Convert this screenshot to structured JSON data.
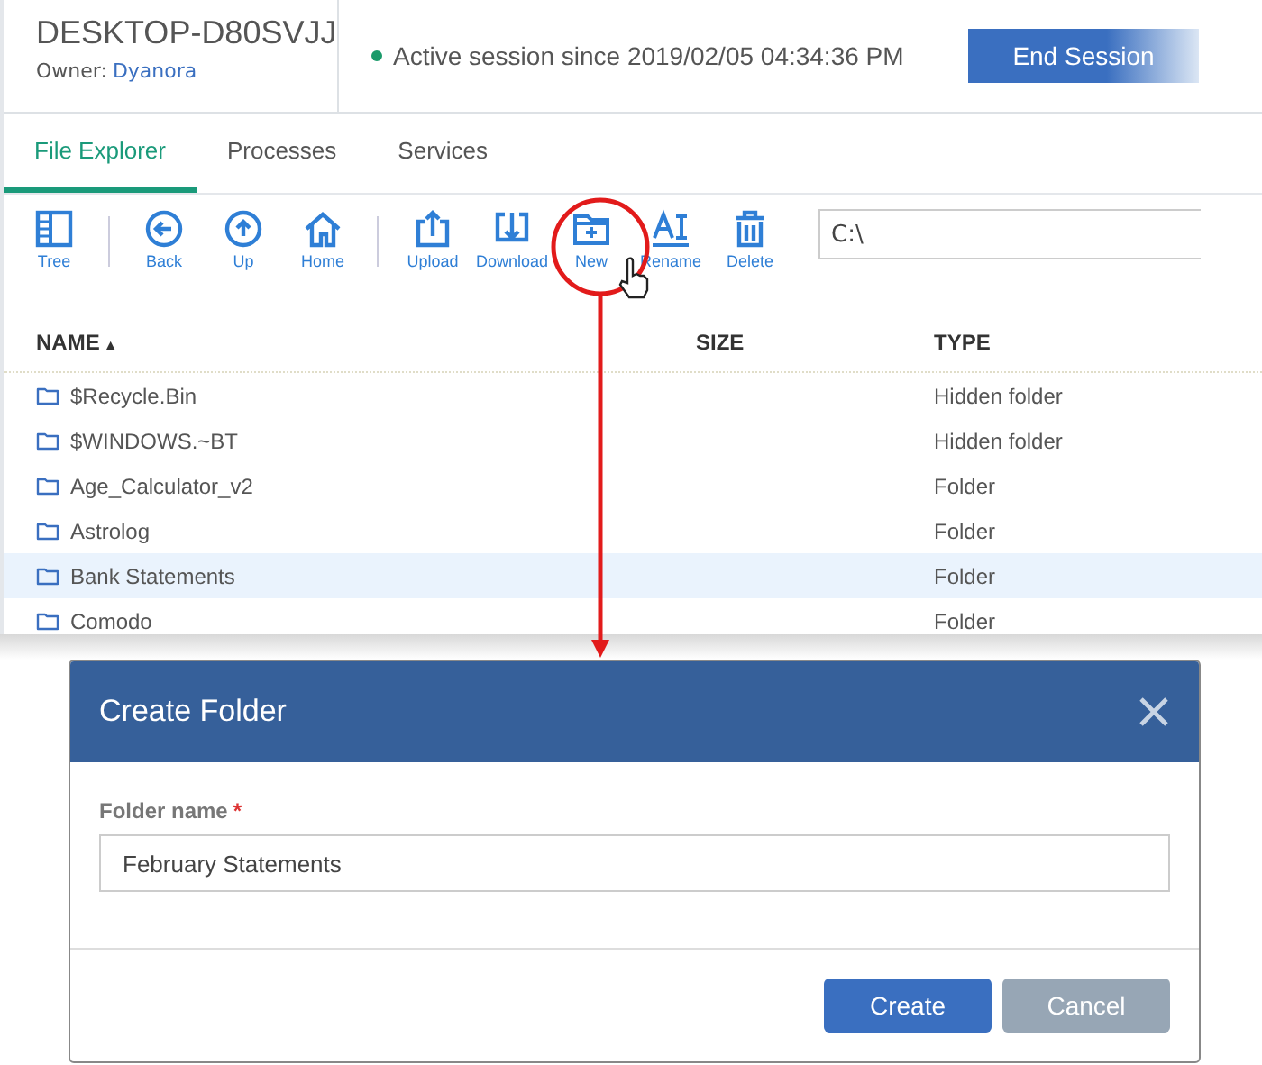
{
  "header": {
    "device": "DESKTOP-D80SVJJ",
    "owner_label": "Owner:",
    "owner": "Dyanora",
    "session": "Active session since 2019/02/05 04:34:36 PM",
    "end_button": "End Session"
  },
  "tabs": [
    {
      "label": "File Explorer",
      "selected": true
    },
    {
      "label": "Processes",
      "selected": false
    },
    {
      "label": "Services",
      "selected": false
    }
  ],
  "toolbar": [
    {
      "kind": "tree",
      "label": "Tree"
    },
    {
      "kind": "separator"
    },
    {
      "kind": "back",
      "label": "Back"
    },
    {
      "kind": "up",
      "label": "Up"
    },
    {
      "kind": "home",
      "label": "Home"
    },
    {
      "kind": "separator"
    },
    {
      "kind": "upload",
      "label": "Upload"
    },
    {
      "kind": "download",
      "label": "Download"
    },
    {
      "kind": "new",
      "label": "New"
    },
    {
      "kind": "rename",
      "label": "Rename"
    },
    {
      "kind": "delete",
      "label": "Delete"
    }
  ],
  "path": "C:\\",
  "table": {
    "columns": [
      "NAME",
      "SIZE",
      "TYPE"
    ],
    "sort_indicator": "▲",
    "rows": [
      {
        "name": "$Recycle.Bin",
        "type": "Hidden folder",
        "selected": false
      },
      {
        "name": "$WINDOWS.~BT",
        "type": "Hidden folder",
        "selected": false
      },
      {
        "name": "Age_Calculator_v2",
        "type": "Folder",
        "selected": false
      },
      {
        "name": "Astrolog",
        "type": "Folder",
        "selected": false
      },
      {
        "name": "Bank Statements",
        "type": "Folder",
        "selected": true
      },
      {
        "name": "Comodo",
        "type": "Folder",
        "selected": false
      }
    ]
  },
  "dialog": {
    "title": "Create Folder",
    "field_label": "Folder name",
    "required_mark": "*",
    "value": "February Statements",
    "buttons": [
      {
        "label": "Create",
        "kind": "primary"
      },
      {
        "label": "Cancel",
        "kind": "secondary"
      }
    ]
  }
}
